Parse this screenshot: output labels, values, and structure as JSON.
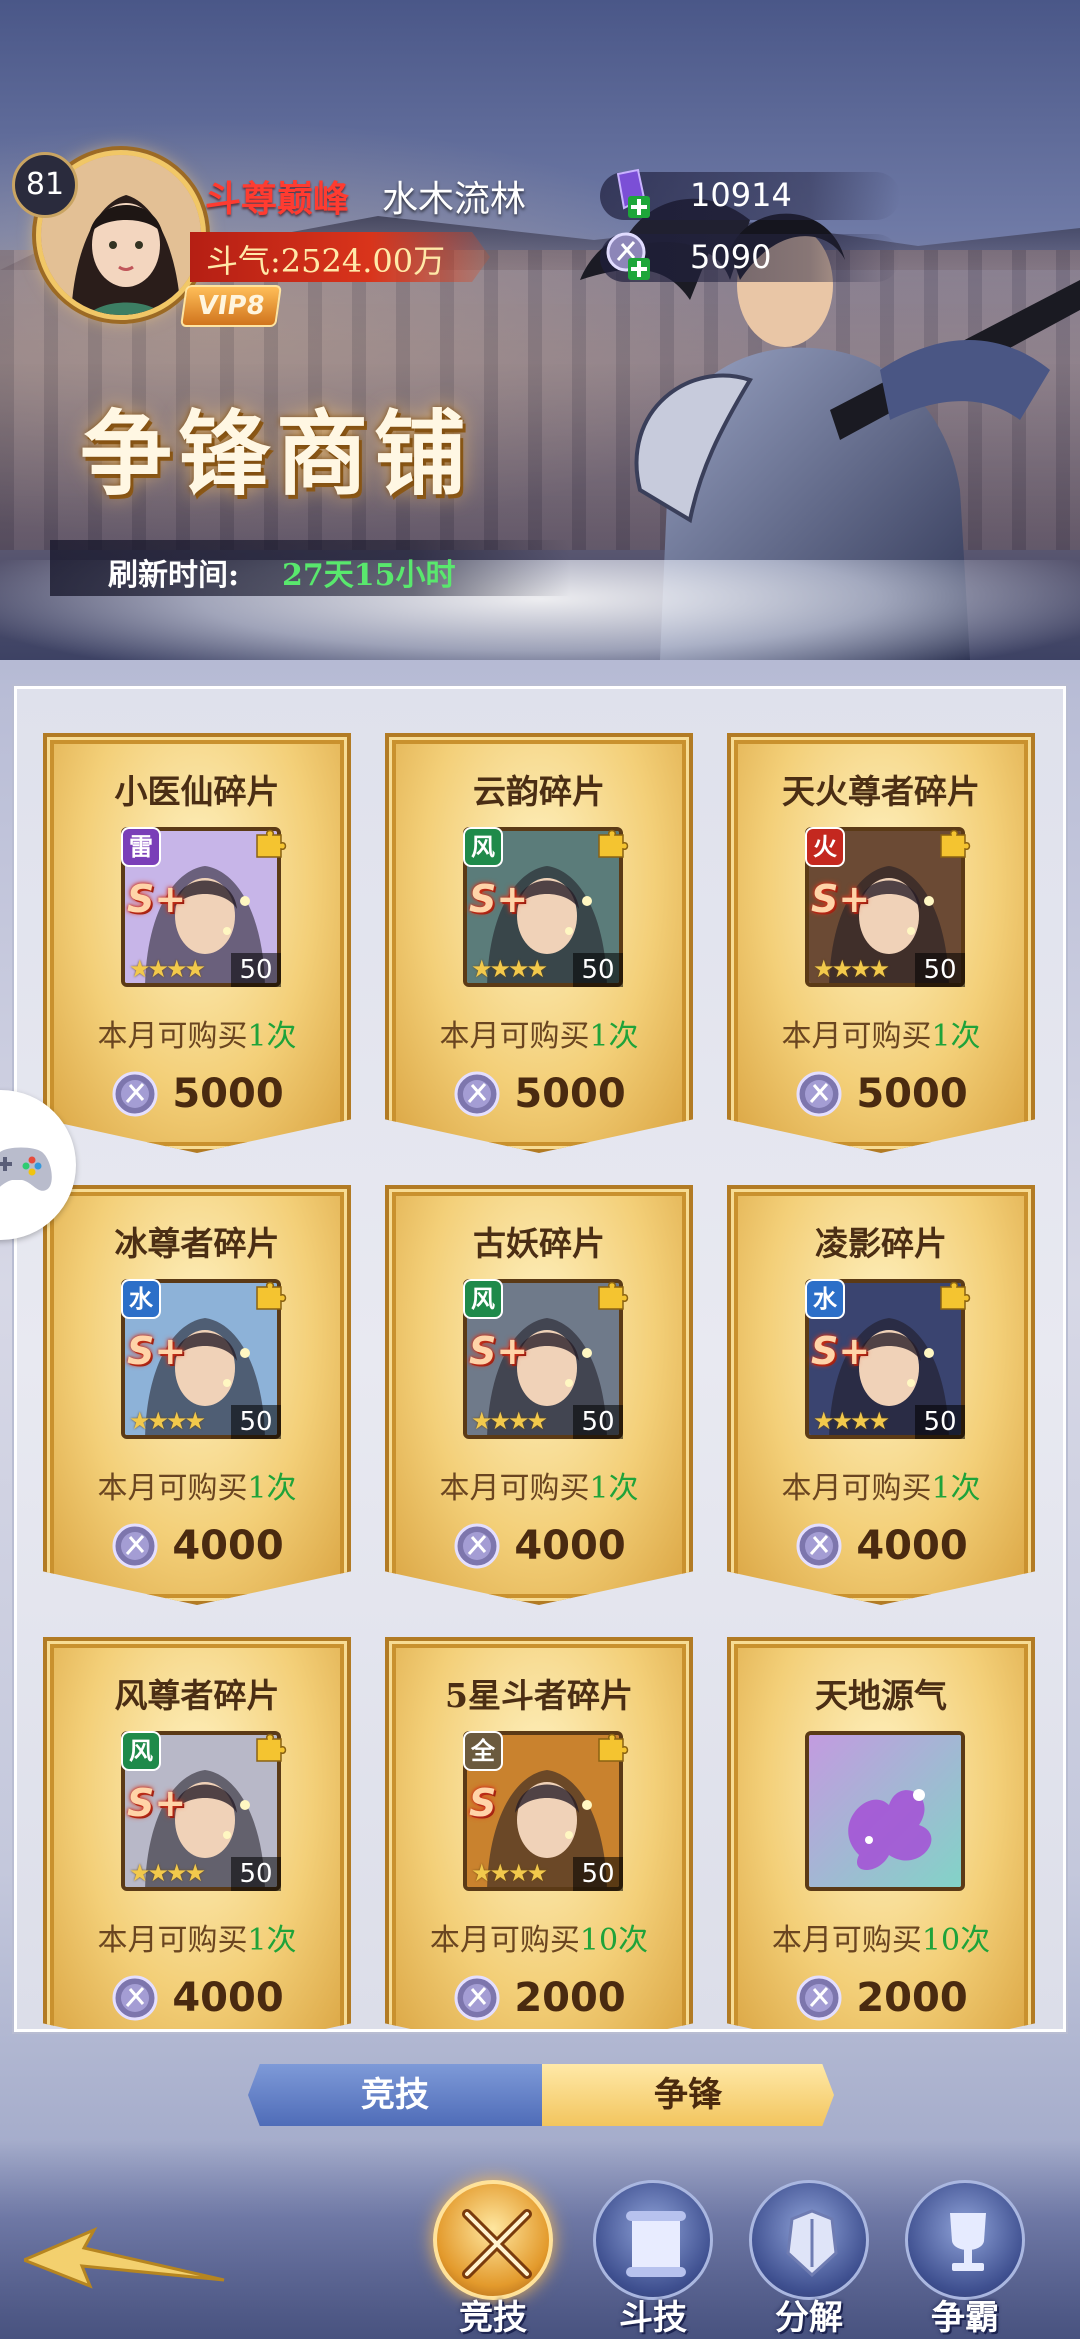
{
  "player": {
    "level": "81",
    "vip": "VIP8",
    "rank_title": "斗尊巅峰",
    "name": "水木流林",
    "power": "斗气:2524.00万"
  },
  "currencies": [
    {
      "icon": "purple-crystal-icon",
      "value": "10914"
    },
    {
      "icon": "arena-coin-icon",
      "value": "5090"
    }
  ],
  "shop": {
    "title": "争锋商铺",
    "refresh_label": "刷新时间:",
    "refresh_value": "27天15小时"
  },
  "items": [
    {
      "name": "小医仙碎片",
      "element": "雷",
      "grade": "S+",
      "count": "50",
      "limit_prefix": "本月可购买",
      "limit_num": "1次",
      "price": "5000"
    },
    {
      "name": "云韵碎片",
      "element": "风",
      "grade": "S+",
      "count": "50",
      "limit_prefix": "本月可购买",
      "limit_num": "1次",
      "price": "5000"
    },
    {
      "name": "天火尊者碎片",
      "element": "火",
      "grade": "S+",
      "count": "50",
      "limit_prefix": "本月可购买",
      "limit_num": "1次",
      "price": "5000"
    },
    {
      "name": "冰尊者碎片",
      "element": "水",
      "grade": "S+",
      "count": "50",
      "limit_prefix": "本月可购买",
      "limit_num": "1次",
      "price": "4000"
    },
    {
      "name": "古妖碎片",
      "element": "风",
      "grade": "S+",
      "count": "50",
      "limit_prefix": "本月可购买",
      "limit_num": "1次",
      "price": "4000"
    },
    {
      "name": "凌影碎片",
      "element": "水",
      "grade": "S+",
      "count": "50",
      "limit_prefix": "本月可购买",
      "limit_num": "1次",
      "price": "4000"
    },
    {
      "name": "风尊者碎片",
      "element": "风",
      "grade": "S+",
      "count": "50",
      "limit_prefix": "本月可购买",
      "limit_num": "1次",
      "price": "4000"
    },
    {
      "name": "5星斗者碎片",
      "element": "全",
      "grade": "S",
      "count": "50",
      "limit_prefix": "本月可购买",
      "limit_num": "10次",
      "price": "2000"
    },
    {
      "name": "天地源气",
      "element": "",
      "grade": "",
      "count": "",
      "limit_prefix": "本月可购买",
      "limit_num": "10次",
      "price": "2000"
    }
  ],
  "segment": {
    "left": "竞技",
    "right": "争锋"
  },
  "nav": [
    {
      "label": "竞技",
      "icon": "crossed-swords-icon",
      "active": true
    },
    {
      "label": "斗技",
      "icon": "scroll-icon",
      "active": false
    },
    {
      "label": "分解",
      "icon": "armor-icon",
      "active": false
    },
    {
      "label": "争霸",
      "icon": "trophy-icon",
      "active": false
    }
  ],
  "colors": {
    "limit_num": "#1fa33a",
    "rank_title": "#ff3b30",
    "refresh_value": "#59e86d",
    "card_gold": "#f3cf78"
  }
}
